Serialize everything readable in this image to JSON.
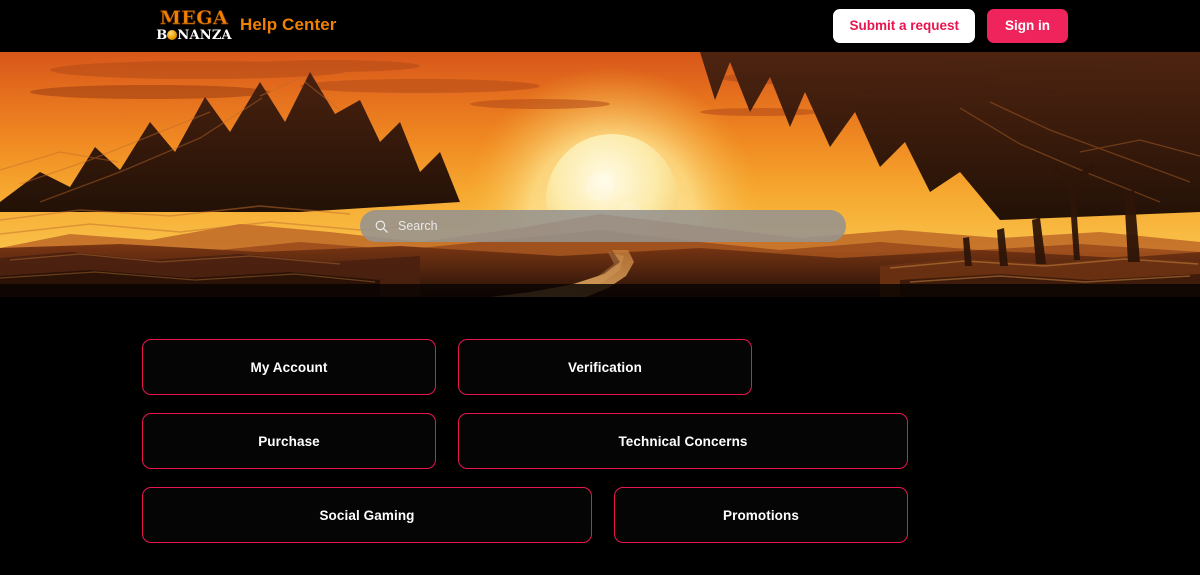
{
  "header": {
    "logo": {
      "top_text": "MEGA",
      "bottom_prefix": "B",
      "bottom_suffix": "NANZA",
      "alt": "Mega Bonanza"
    },
    "site_title": "Help Center",
    "submit_request_label": "Submit a request",
    "sign_in_label": "Sign in",
    "background_color": "#000000",
    "accent_orange": "#F08000",
    "accent_pink": "#F0245C"
  },
  "hero": {
    "scene_description": "Desert canyon landscape at sunset with large sun rising behind dunes",
    "search": {
      "placeholder": "Search",
      "value": "",
      "icon": "search-icon"
    },
    "colors": {
      "sky_top": "#E0651A",
      "sky_mid": "#F08A22",
      "sky_low": "#F7B43C",
      "sun": "#FCEAA8",
      "dune_far": "#C06828",
      "dune_near": "#8A4018",
      "ground": "#3A1A0A",
      "cliff_dark": "#2A1409",
      "search_bar": "#96938E"
    }
  },
  "categories": {
    "items": [
      {
        "label": "My Account",
        "width": "third"
      },
      {
        "label": "Verification",
        "width": "third"
      },
      {
        "label": "Purchase",
        "width": "third"
      },
      {
        "label": "Technical Concerns",
        "width": "half"
      },
      {
        "label": "Social Gaming",
        "width": "half"
      },
      {
        "label": "Promotions",
        "width": "third"
      }
    ],
    "border_color": "#E8164F",
    "text_color": "#FFFFFF",
    "background_color": "#000000"
  }
}
